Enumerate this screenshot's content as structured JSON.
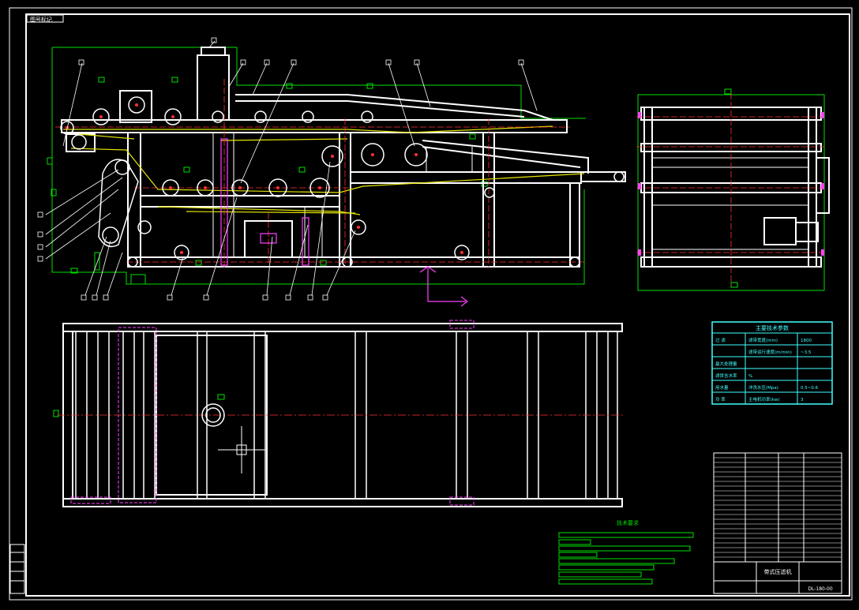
{
  "drawing": {
    "corner_tag": "图号标记",
    "title_block": {
      "name": "带式压滤机",
      "drawing_no": "DL-180-00"
    },
    "spec_table": {
      "title": "主要技术参数",
      "rows": [
        {
          "group": "过 滤",
          "label": "滤带宽度(mm)",
          "value": "1800"
        },
        {
          "group": "",
          "label": "滤带运行速度(m/min)",
          "value": "~3.5"
        },
        {
          "group": "最大处理量",
          "label": "",
          "value": ""
        },
        {
          "group": "滤饼含水率",
          "label": "%",
          "value": ""
        },
        {
          "group": "用水量",
          "label": "冲洗水压(Mpa)",
          "value": "0.5~0.6"
        },
        {
          "group": "功 率",
          "label": "主电机功率(kw)",
          "value": "3"
        }
      ]
    },
    "notes_title": "技术要求",
    "colors": {
      "frame": "#ffffff",
      "belt_yellow": "#e6e600",
      "center_red": "#ff3030",
      "aux_green": "#00e000",
      "marker_magenta": "#ff40ff",
      "spec_cyan": "#40ffff"
    }
  }
}
